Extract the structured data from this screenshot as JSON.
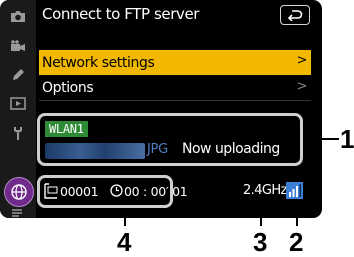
{
  "screen": {
    "title": "Connect to FTP server",
    "menu": [
      {
        "label": "Network settings",
        "arrow": ">",
        "selected": true
      },
      {
        "label": "Options",
        "arrow": ">",
        "selected": false
      }
    ],
    "status": {
      "network": "WLAN1",
      "file_ext": "JPG",
      "upload_status": "Now uploading"
    },
    "bottom": {
      "remaining_count": "00001",
      "remaining_time": "00 : 00′ 01",
      "band": "2.4GHz"
    },
    "colors": {
      "highlight": "#f2b800",
      "wlan_badge": "#2f8a35",
      "file_ext": "#4f7fc4",
      "active_tab": "#6f2a8c",
      "signal": "#3d7fd6"
    }
  },
  "callouts": [
    "1",
    "2",
    "3",
    "4"
  ]
}
